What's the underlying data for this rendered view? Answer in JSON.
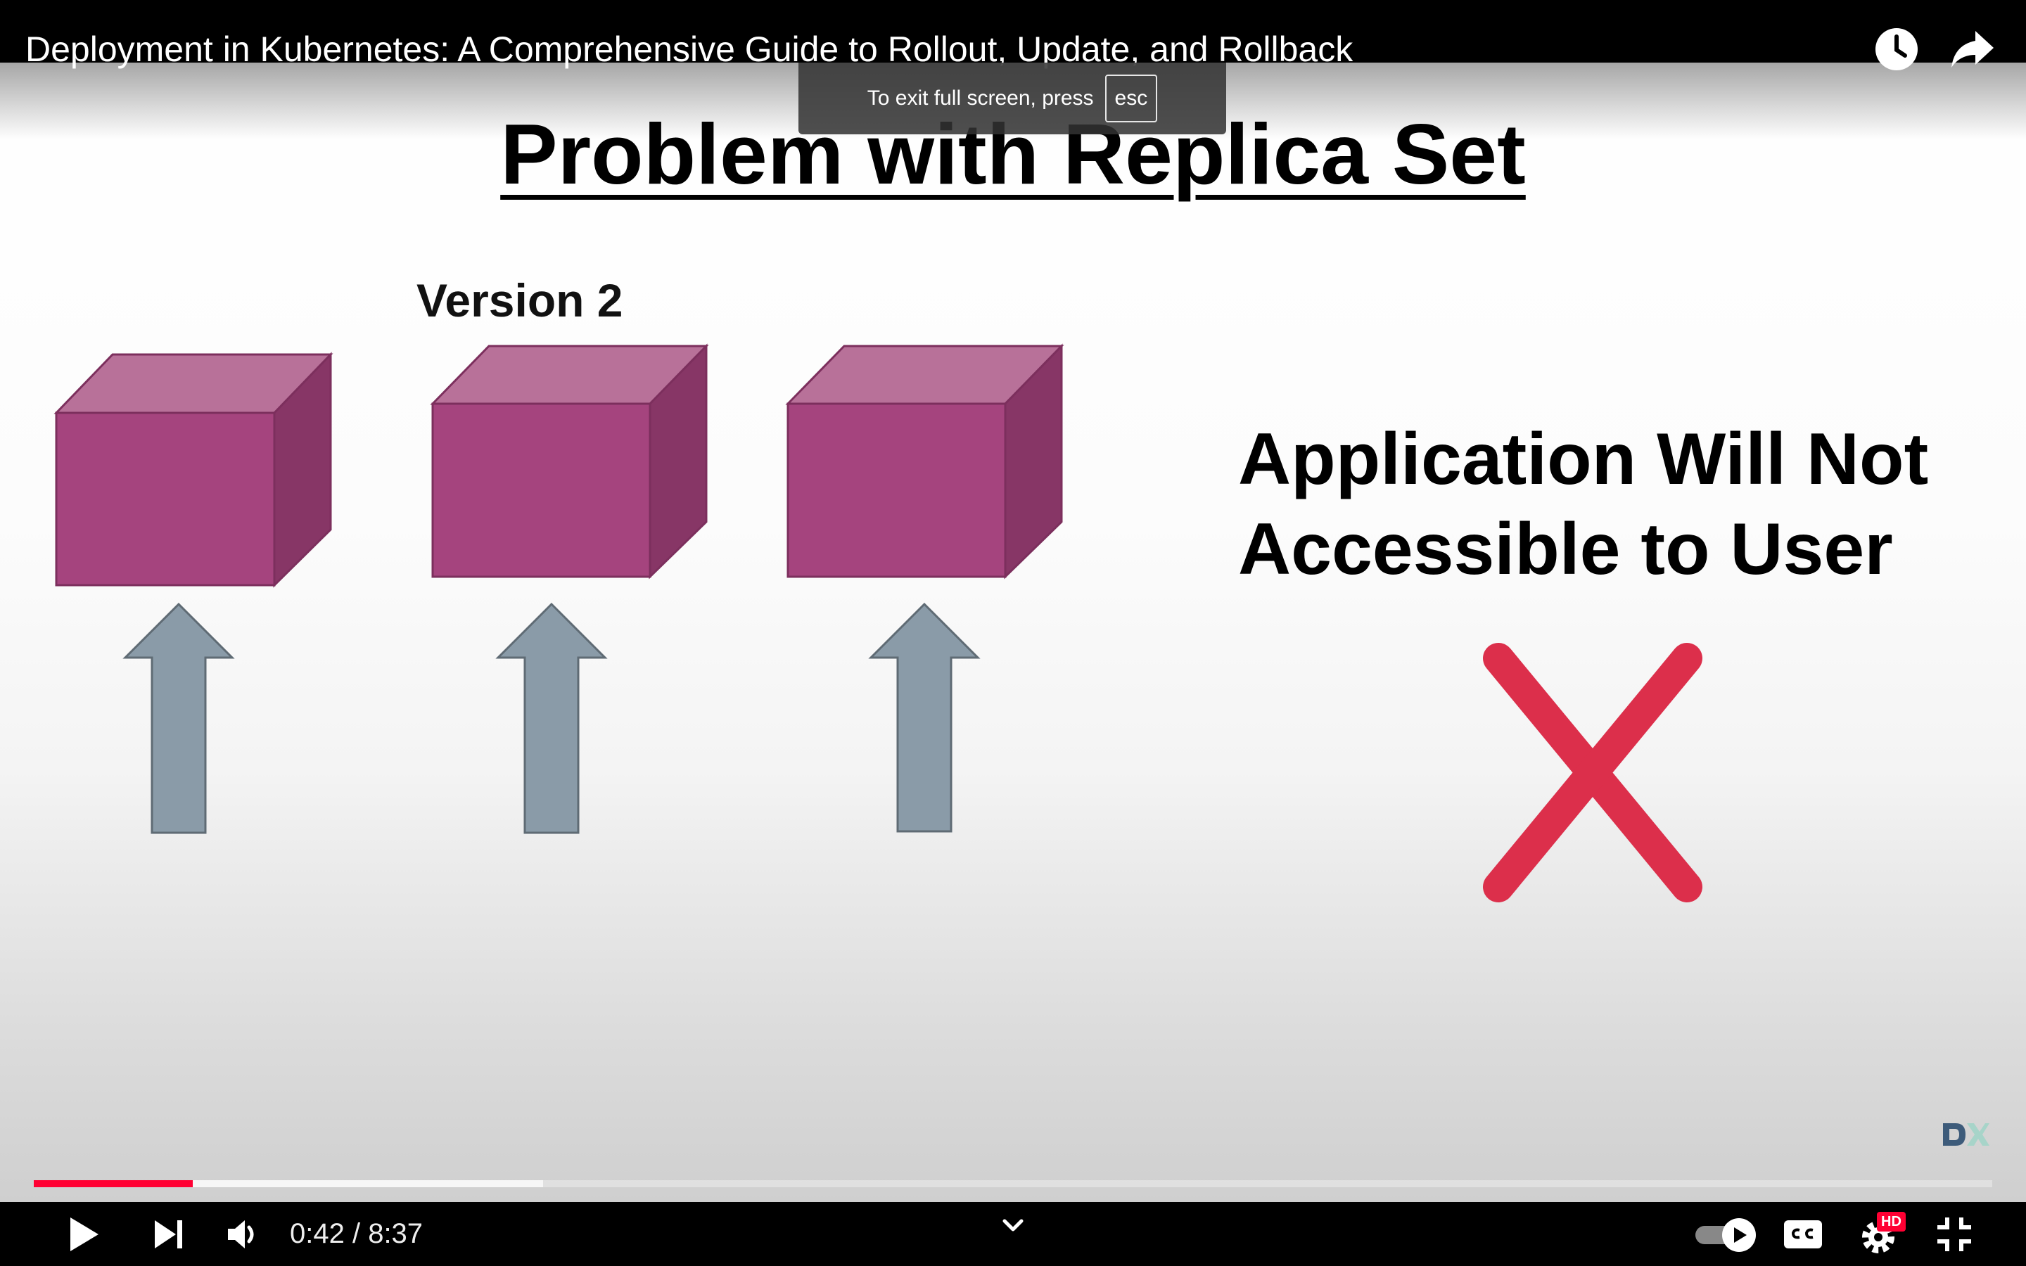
{
  "player": {
    "title": "Deployment in Kubernetes: A Comprehensive Guide to Rollout, Update, and Rollback",
    "toast": {
      "text": "To exit full screen, press",
      "key": "esc"
    },
    "icons": {
      "watch_later": "clock-icon",
      "share": "share-arrow-icon"
    }
  },
  "slide": {
    "title": "Problem with Replica Set",
    "version_label": "Version 2",
    "message_line1": "Application Will Not",
    "message_line2": "Accessible to User",
    "cubes": 3,
    "arrows": 3,
    "cube_color": "#a5447e",
    "arrow_color": "#8a9ba8",
    "cross_color": "#dc2f4b",
    "logo_text": "DX"
  },
  "controls": {
    "current_time": "0:42",
    "duration": "8:37",
    "time_text": "0:42 / 8:37",
    "progress_fraction": 0.081,
    "buffered_fraction": 0.26,
    "hd_label": "HD",
    "cc_label": "CC",
    "accent_color": "#ff0033",
    "icons": [
      "play-icon",
      "skip-next-icon",
      "volume-icon",
      "chevron-down-icon",
      "autoplay-toggle-icon",
      "closed-captions-icon",
      "settings-gear-icon",
      "exit-fullscreen-icon"
    ]
  }
}
